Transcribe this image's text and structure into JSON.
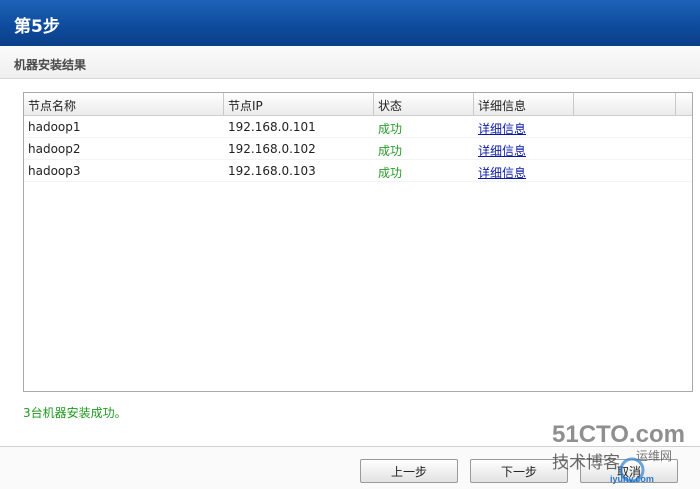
{
  "window": {
    "title": "第5步"
  },
  "section": {
    "title": "机器安装结果"
  },
  "table": {
    "columns": [
      "节点名称",
      "节点IP",
      "状态",
      "详细信息"
    ],
    "rows": [
      {
        "name": "hadoop1",
        "ip": "192.168.0.101",
        "status": "成功",
        "detail": "详细信息"
      },
      {
        "name": "hadoop2",
        "ip": "192.168.0.102",
        "status": "成功",
        "detail": "详细信息"
      },
      {
        "name": "hadoop3",
        "ip": "192.168.0.103",
        "status": "成功",
        "detail": "详细信息"
      }
    ]
  },
  "message": "3台机器安装成功。",
  "buttons": {
    "prev": "上一步",
    "next": "下一步",
    "cancel": "取消"
  },
  "watermark": {
    "site": "51CTO.com",
    "line2": "技术博客",
    "line3": "运维网",
    "line4": "iyunv.com"
  },
  "colors": {
    "titlebar": "#0f4c9e",
    "success": "#2a9a2a",
    "link": "#0a1aa6"
  }
}
